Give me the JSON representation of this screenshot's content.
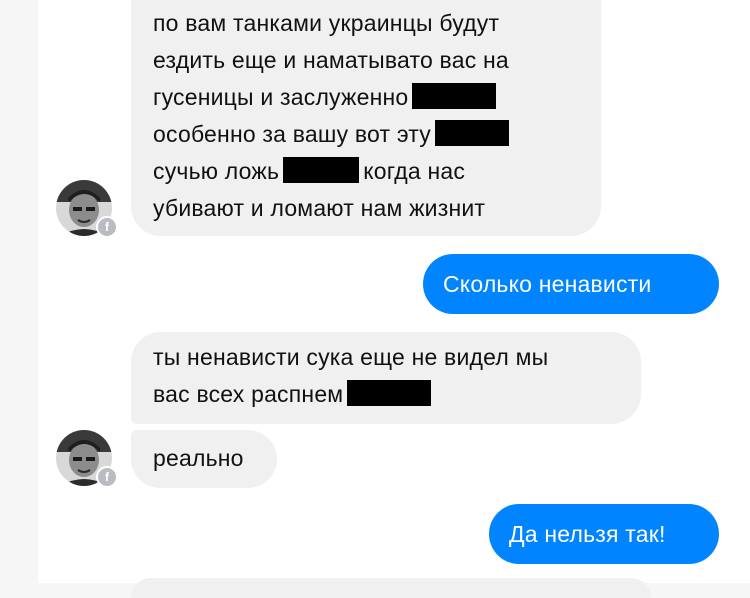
{
  "conversation": {
    "messages": [
      {
        "side": "in",
        "lines": [
          "по вам танками украинцы будут",
          "ездить еще и наматывато вас на",
          "гусеницы и заслуженно",
          "особенно за вашу вот эту",
          "сучью ложь",
          "когда нас",
          "убивают и ломают нам жизнит"
        ]
      },
      {
        "side": "out",
        "text": "Сколько ненависти"
      },
      {
        "side": "in",
        "lines": [
          "ты ненависти сука еще не видел мы",
          "вас всех распнем"
        ]
      },
      {
        "side": "in",
        "text": "реально"
      },
      {
        "side": "out",
        "text": "Да нельзя так!"
      }
    ],
    "avatar_badge": "f",
    "colors": {
      "outgoing_bubble": "#0084ff",
      "incoming_bubble": "#f0f0f0",
      "redaction": "#000000",
      "badge": "#b9bcc1"
    }
  }
}
